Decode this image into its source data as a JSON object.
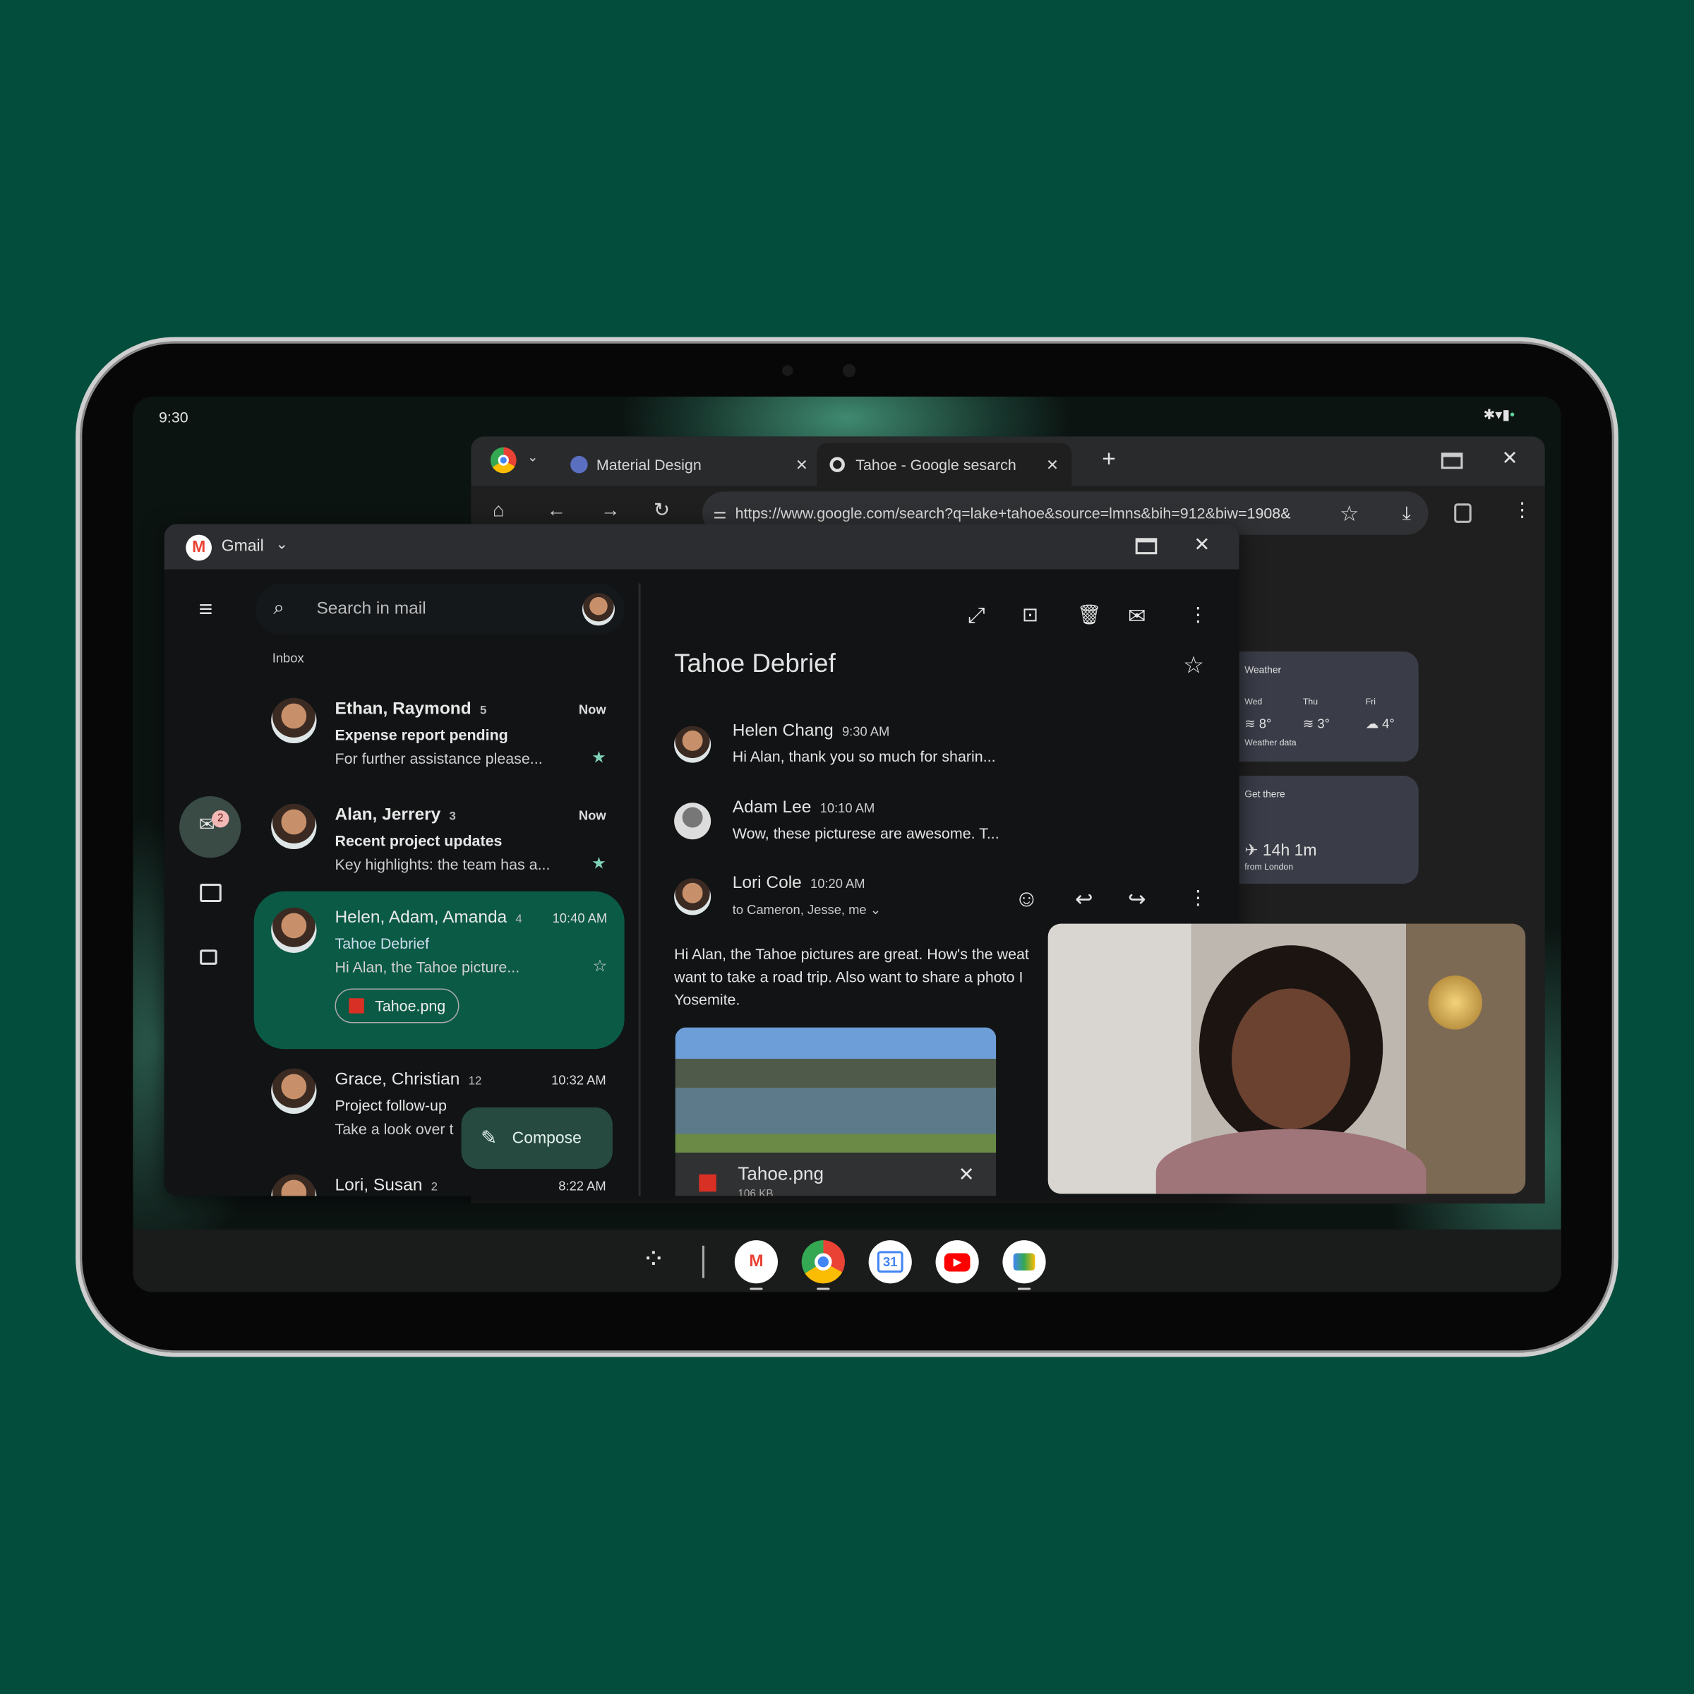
{
  "status_bar": {
    "time": "9:30"
  },
  "chrome": {
    "tabs": [
      {
        "label": "Material Design",
        "close": "✕"
      },
      {
        "label": "Tahoe - Google sesarch",
        "close": "✕"
      }
    ],
    "new_tab": "+",
    "url": "https://www.google.com/search?q=lake+tahoe&source=lmns&bih=912&biw=1908&",
    "weather_card": {
      "title": "Weather",
      "days": [
        {
          "day": "Wed",
          "temp": "8°"
        },
        {
          "day": "Thu",
          "temp": "3°"
        },
        {
          "day": "Fri",
          "temp": "4°"
        }
      ],
      "footer": "Weather data"
    },
    "travel_card": {
      "title": "Get there",
      "duration": "14h 1m",
      "from": "from London"
    }
  },
  "gmail": {
    "app_name": "Gmail",
    "search_placeholder": "Search in mail",
    "folder": "Inbox",
    "unread_badge": "2",
    "compose": "Compose",
    "threads": [
      {
        "from": "Ethan, Raymond",
        "count": "5",
        "time": "Now",
        "subject": "Expense report pending",
        "snippet": "For further assistance please...",
        "starred": true,
        "unread": true
      },
      {
        "from": "Alan, Jerrery",
        "count": "3",
        "time": "Now",
        "subject": "Recent project updates",
        "snippet": "Key highlights: the team has a...",
        "starred": true,
        "unread": true
      },
      {
        "from": "Helen, Adam, Amanda",
        "count": "4",
        "time": "10:40 AM",
        "subject": "Tahoe Debrief",
        "snippet": "Hi Alan, the Tahoe picture...",
        "attachment": "Tahoe.png",
        "starred": false,
        "selected": true
      },
      {
        "from": "Grace, Christian",
        "count": "12",
        "time": "10:32 AM",
        "subject": "Project follow-up",
        "snippet": "Take a look over t"
      },
      {
        "from": "Lori, Susan",
        "count": "2",
        "time": "8:22 AM"
      }
    ],
    "reading": {
      "title": "Tahoe Debrief",
      "messages": [
        {
          "name": "Helen Chang",
          "time": "9:30 AM",
          "snippet": "Hi Alan, thank you so much for sharin..."
        },
        {
          "name": "Adam Lee",
          "time": "10:10 AM",
          "snippet": "Wow, these picturese are awesome. T..."
        },
        {
          "name": "Lori Cole",
          "time": "10:20 AM",
          "to": "to Cameron, Jesse, me"
        }
      ],
      "body": "Hi Alan, the Tahoe pictures are great. How's the weat\nwant to take a road trip. Also want to share a photo I\nYosemite.",
      "attachment": {
        "name": "Tahoe.png",
        "size": "106 KB"
      }
    }
  },
  "dock": {
    "apps": [
      "Gmail",
      "Chrome",
      "Calendar",
      "YouTube",
      "Meet"
    ],
    "calendar_day": "31"
  },
  "colors": {
    "background": "#024d3c",
    "selected_thread": "#0b5a45",
    "accent": "#7fd1b5"
  }
}
